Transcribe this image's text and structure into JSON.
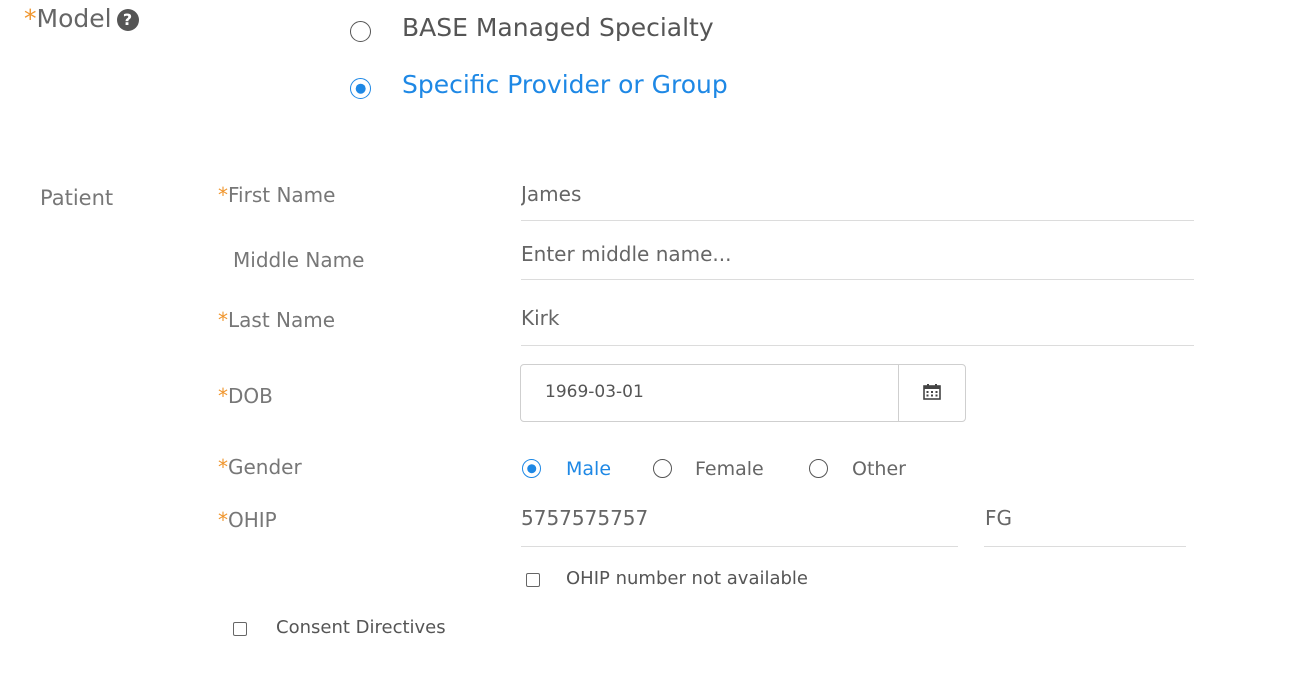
{
  "model": {
    "required_mark": "*",
    "label": "Model",
    "help_icon": "question-circle-icon",
    "options": [
      {
        "label": "BASE Managed Specialty",
        "selected": false
      },
      {
        "label": "Specific Provider or Group",
        "selected": true
      }
    ]
  },
  "patient": {
    "section_label": "Patient",
    "required_mark": "*",
    "first_name": {
      "label": "First Name",
      "value": "James",
      "required": true
    },
    "middle_name": {
      "label": "Middle Name",
      "value": "",
      "placeholder": "Enter middle name...",
      "required": false
    },
    "last_name": {
      "label": "Last Name",
      "value": "Kirk",
      "required": true
    },
    "dob": {
      "label": "DOB",
      "value": "1969-03-01",
      "required": true,
      "icon": "calendar-icon"
    },
    "gender": {
      "label": "Gender",
      "required": true,
      "options": [
        {
          "label": "Male",
          "selected": true
        },
        {
          "label": "Female",
          "selected": false
        },
        {
          "label": "Other",
          "selected": false
        }
      ]
    },
    "ohip": {
      "label": "OHIP",
      "required": true,
      "number": "5757575757",
      "version_code": "FG",
      "not_available_label": "OHIP number not available",
      "not_available_checked": false
    },
    "consent_directives": {
      "label": "Consent Directives",
      "checked": false
    }
  },
  "colors": {
    "accent": "#1e88e5",
    "required": "#f0962e",
    "text": "#666666",
    "divider": "#dcdcdc"
  }
}
